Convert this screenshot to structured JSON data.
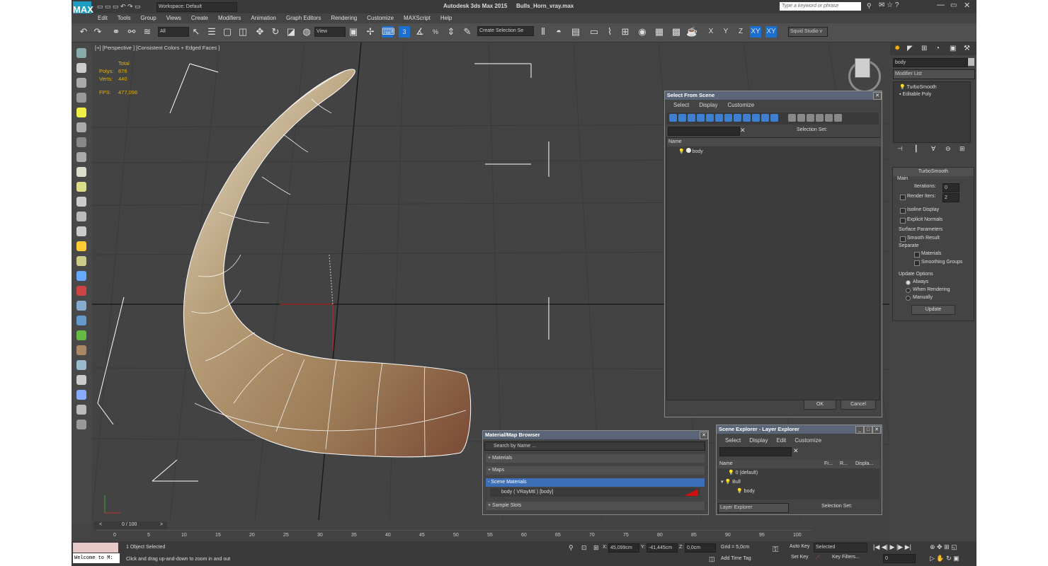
{
  "title": {
    "app": "Autodesk 3ds Max  2015",
    "file": "Bulls_Horn_vray.max",
    "workspace": "Workspace: Default",
    "search_placeholder": "Type a keyword or phrase",
    "logo": "MAX"
  },
  "menu": [
    "Edit",
    "Tools",
    "Group",
    "Views",
    "Create",
    "Modifiers",
    "Animation",
    "Graph Editors",
    "Rendering",
    "Customize",
    "MAXScript",
    "Help"
  ],
  "toolbar": {
    "filter": "All",
    "view": "View",
    "selection_set": "Create Selection Se",
    "axes": [
      "X",
      "Y",
      "Z",
      "XY",
      "XY"
    ],
    "studio": "Squid Studio v"
  },
  "viewport": {
    "label": "[+] [Perspective ] [Consistent Colors + Edged Faces ]",
    "stats_header": "Total",
    "polys_label": "Polys:",
    "polys_value": "876",
    "verts_label": "Verts:",
    "verts_value": "440",
    "fps_label": "FPS:",
    "fps_value": "477,096"
  },
  "select_from_scene": {
    "title": "Select From Scene",
    "menu": [
      "Select",
      "Display",
      "Customize"
    ],
    "selection_set_label": "Selection Set:",
    "column_name": "Name",
    "items": [
      "body"
    ],
    "ok": "OK",
    "cancel": "Cancel"
  },
  "material_browser": {
    "title": "Material/Map Browser",
    "search_placeholder": "Search by Name ...",
    "sections": [
      "+ Materials",
      "+ Maps",
      "- Scene Materials"
    ],
    "scene_material": "body  ( VRayMtl )  [body]",
    "sample_slots": "+ Sample Slots"
  },
  "scene_explorer": {
    "title": "Scene Explorer - Layer Explorer",
    "menu": [
      "Select",
      "Display",
      "Edit",
      "Customize"
    ],
    "columns": [
      "Name",
      "Fr...",
      "R...",
      "Displa..."
    ],
    "rows": [
      "0 (default)",
      "Bull",
      "body"
    ],
    "explorer_type": "Layer Explorer",
    "selection_set_label": "Selection Set:"
  },
  "command_panel": {
    "object_name": "body",
    "modifier_list": "Modifier List",
    "stack": [
      "TurboSmooth",
      "Editable Poly"
    ],
    "rollout_title": "TurboSmooth",
    "main_label": "Main",
    "iterations_label": "Iterations:",
    "iterations_value": "0",
    "render_iters_label": "Render Iters:",
    "render_iters_value": "2",
    "isoline": "Isoline Display",
    "explicit_normals": "Explicit Normals",
    "surface_params": "Surface Parameters",
    "smooth_result": "Smooth Result",
    "separate": "Separate",
    "materials": "Materials",
    "smoothing_groups": "Smoothing Groups",
    "update_options": "Update Options",
    "always": "Always",
    "when_rendering": "When Rendering",
    "manually": "Manually",
    "update_button": "Update"
  },
  "timeline": {
    "frame_counter": "0 / 100",
    "ticks": [
      "0",
      "5",
      "10",
      "15",
      "20",
      "25",
      "30",
      "35",
      "40",
      "45",
      "50",
      "55",
      "60",
      "65",
      "70",
      "75",
      "80",
      "85",
      "90",
      "95",
      "100"
    ]
  },
  "status": {
    "listener": "Welcome to M:",
    "selection": "1 Object Selected",
    "prompt": "Click and drag up-and-down to zoom in and out",
    "x_label": "X:",
    "x_value": "45,099cm",
    "y_label": "Y:",
    "y_value": "-41,445cm",
    "z_label": "Z:",
    "z_value": "0,0cm",
    "grid": "Grid = 5,0cm",
    "add_time_tag": "Add Time Tag",
    "auto_key": "Auto Key",
    "set_key": "Set Key",
    "key_mode": "Selected",
    "key_filters": "Key Filters...",
    "frame_value": "0"
  }
}
